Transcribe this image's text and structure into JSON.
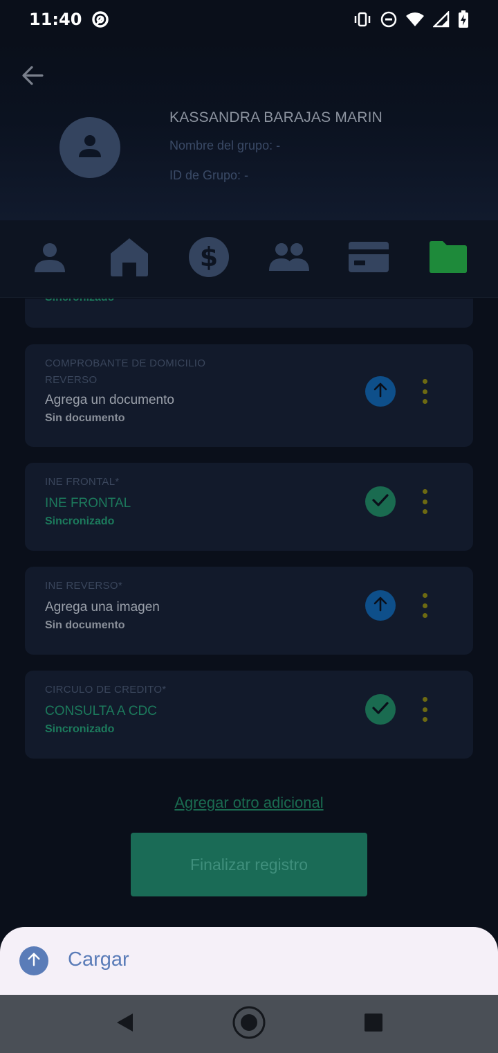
{
  "status_bar": {
    "time": "11:40"
  },
  "header": {
    "client_name": "KASSANDRA BARAJAS MARIN",
    "group_name_line": "Nombre del grupo: -",
    "group_id_line": "ID de Grupo: -"
  },
  "tabs": [
    {
      "icon": "person-icon",
      "active": false
    },
    {
      "icon": "home-icon",
      "active": false
    },
    {
      "icon": "dollar-icon",
      "active": false
    },
    {
      "icon": "group-icon",
      "active": false
    },
    {
      "icon": "card-icon",
      "active": false
    },
    {
      "icon": "folder-icon",
      "active": true
    }
  ],
  "documents": {
    "partial_status": "Sincronizado",
    "items": [
      {
        "title": "COMPROBANTE DE DOMICILIO\nREVERSO",
        "value": "Agrega un documento",
        "status": "Sin documento",
        "action": "upload"
      },
      {
        "title": "INE FRONTAL*",
        "value": "INE FRONTAL",
        "status": "Sincronizado",
        "action": "done"
      },
      {
        "title": "INE REVERSO*",
        "value": "Agrega una imagen",
        "status": "Sin documento",
        "action": "upload"
      },
      {
        "title": "CIRCULO DE CREDITO*",
        "value": "CONSULTA A CDC",
        "status": "Sincronizado",
        "action": "done"
      }
    ]
  },
  "add_link": "Agregar otro adicional",
  "finish_button": "Finalizar registro",
  "sheet": {
    "label": "Cargar"
  },
  "colors": {
    "accent_green": "#1a6b56",
    "upload_blue": "#0e4f8a",
    "folder_green": "#1e8a3a",
    "menu_dots": "#6d6a12"
  }
}
